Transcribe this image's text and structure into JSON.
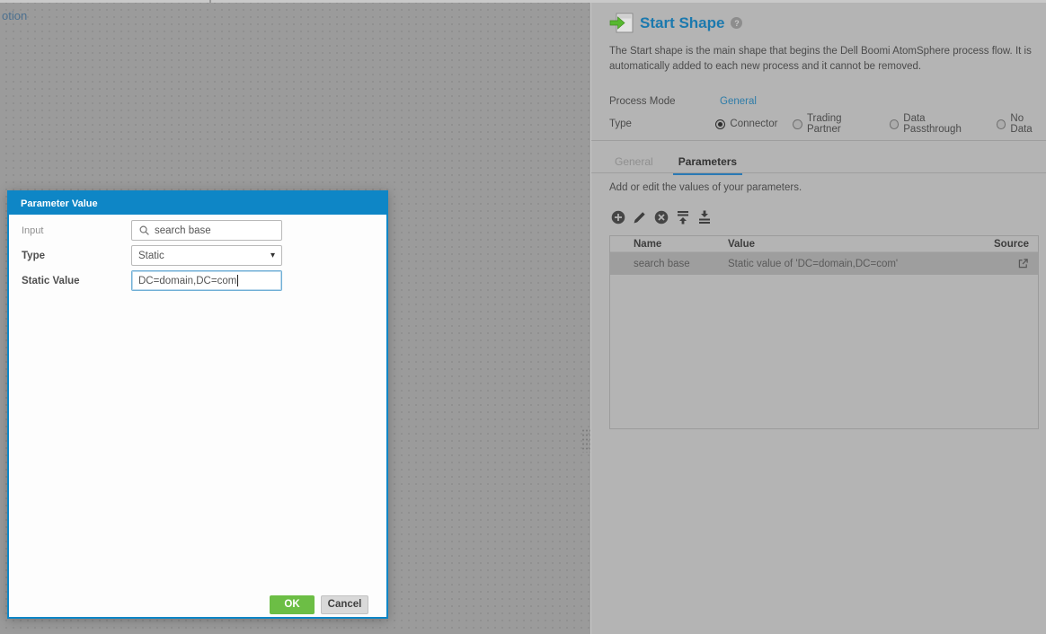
{
  "canvas": {
    "partial_label": "otion"
  },
  "panel": {
    "header": {
      "title": "Start Shape",
      "help": "?"
    },
    "description": "The Start shape is the main shape that begins the Dell Boomi AtomSphere process flow. It is automatically added to each new process and it cannot be removed.",
    "process_mode": {
      "label": "Process Mode",
      "value": "General"
    },
    "type": {
      "label": "Type",
      "options": [
        {
          "label": "Connector",
          "selected": true
        },
        {
          "label": "Trading Partner",
          "selected": false
        },
        {
          "label": "Data Passthrough",
          "selected": false
        },
        {
          "label": "No Data",
          "selected": false
        }
      ]
    },
    "tabs": [
      {
        "label": "General",
        "active": false
      },
      {
        "label": "Parameters",
        "active": true
      }
    ],
    "instructions": "Add or edit the values of your parameters.",
    "toolbar_icons": [
      "add-icon",
      "edit-icon",
      "delete-icon",
      "move-to-top-icon",
      "move-to-bottom-icon"
    ],
    "table": {
      "columns": [
        "Name",
        "Value",
        "Source"
      ],
      "rows": [
        {
          "name": "search base",
          "value": "Static value of 'DC=domain,DC=com'",
          "source_icon": "external-link-icon",
          "selected": true
        }
      ]
    }
  },
  "dialog": {
    "title": "Parameter Value",
    "input_field": {
      "label": "Input",
      "value": "search base",
      "icon": "search-icon"
    },
    "type_field": {
      "label": "Type",
      "value": "Static"
    },
    "static_value_field": {
      "label": "Static Value",
      "value": "DC=domain,DC=com"
    },
    "buttons": {
      "ok": "OK",
      "cancel": "Cancel"
    }
  },
  "colors": {
    "dialog_accent": "#0e86c6",
    "ok_green": "#6cbe45",
    "title_blue": "#1b79ae",
    "link_blue": "#2e7ca8",
    "tab_underline": "#2a79b5",
    "canvas_bg": "#9b9b9b",
    "panel_bg": "#b4b4b4",
    "selected_row_bg": "#9e9e9e"
  }
}
